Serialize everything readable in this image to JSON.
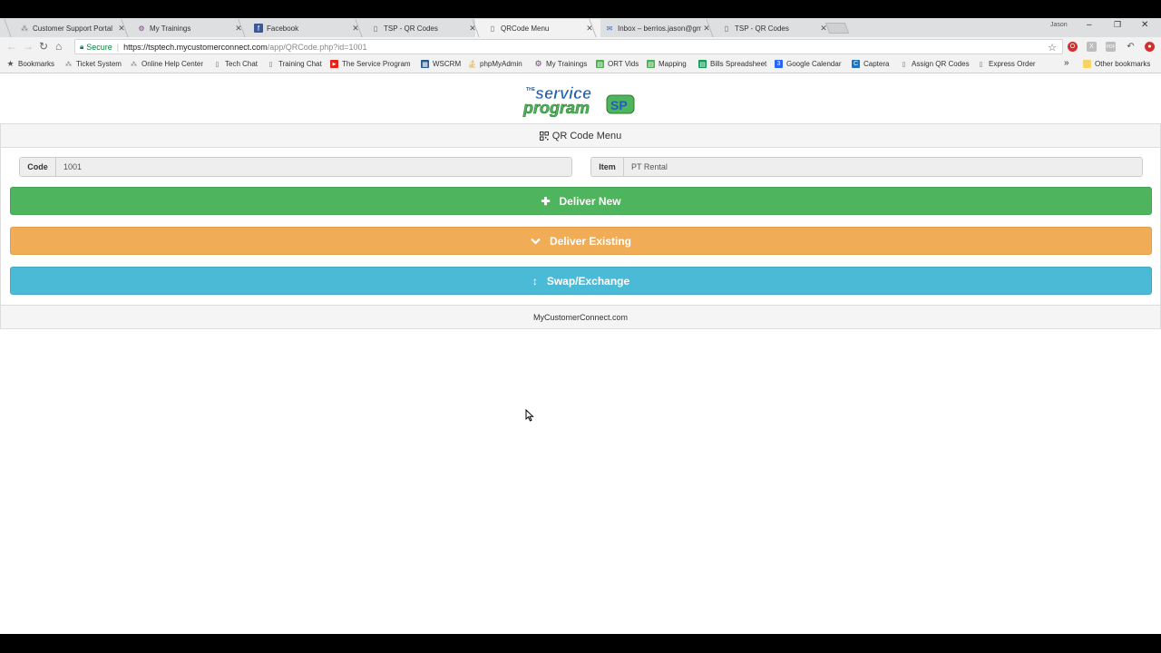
{
  "tabs": [
    {
      "label": "Customer Support Portal",
      "icon": "support-icon"
    },
    {
      "label": "My Trainings",
      "icon": "trainings-icon"
    },
    {
      "label": "Facebook",
      "icon": "facebook-icon"
    },
    {
      "label": "TSP - QR Codes",
      "icon": "page-icon"
    },
    {
      "label": "QRCode Menu",
      "icon": "page-icon",
      "active": true
    },
    {
      "label": "Inbox – berrios.jason@gm",
      "icon": "mail-icon"
    },
    {
      "label": "TSP - QR Codes",
      "icon": "page-icon"
    }
  ],
  "window": {
    "user": "Jason"
  },
  "toolbar": {
    "secure_label": "Secure",
    "url_host": "https://tsptech.mycustomerconnect.com",
    "url_path": "/app/QRCode.php?id=1001"
  },
  "bookmarks": {
    "items": [
      {
        "label": "Bookmarks",
        "icon": "star-icon"
      },
      {
        "label": "Ticket System",
        "icon": "support-icon"
      },
      {
        "label": "Online Help Center",
        "icon": "support-icon"
      },
      {
        "label": "Tech Chat",
        "icon": "page-icon"
      },
      {
        "label": "Training Chat",
        "icon": "page-icon"
      },
      {
        "label": "The Service Program",
        "icon": "youtube-icon"
      },
      {
        "label": "WSCRM",
        "icon": "crm-icon"
      },
      {
        "label": "phpMyAdmin",
        "icon": "phpmyadmin-icon"
      },
      {
        "label": "My Trainings",
        "icon": "trainings-icon"
      },
      {
        "label": "ORT Vids",
        "icon": "sheet-icon"
      },
      {
        "label": "Mapping",
        "icon": "sheet-icon"
      },
      {
        "label": "Bills Spreadsheet",
        "icon": "sheet-icon"
      },
      {
        "label": "Google Calendar",
        "icon": "calendar-icon"
      },
      {
        "label": "Captera",
        "icon": "capterra-icon"
      },
      {
        "label": "Assign QR Codes",
        "icon": "page-icon"
      },
      {
        "label": "Express Order",
        "icon": "page-icon"
      }
    ],
    "overflow_label": "»",
    "other_label": "Other bookmarks"
  },
  "page": {
    "logo_text_top": "THE",
    "logo_text_service": "service",
    "logo_text_program": "program",
    "logo_badge": "SP",
    "panel_title": "QR Code Menu",
    "code_label": "Code",
    "code_value": "1001",
    "item_label": "Item",
    "item_value": "PT Rental",
    "deliver_new_label": "Deliver New",
    "deliver_existing_label": "Deliver Existing",
    "swap_label": "Swap/Exchange",
    "footer_text": "MyCustomerConnect.com"
  },
  "colors": {
    "deliver_new": "#4fb45e",
    "deliver_existing": "#f0ac56",
    "swap": "#4bbad7",
    "logo_blue": "#1f5fb4",
    "logo_green": "#4fb45e"
  }
}
